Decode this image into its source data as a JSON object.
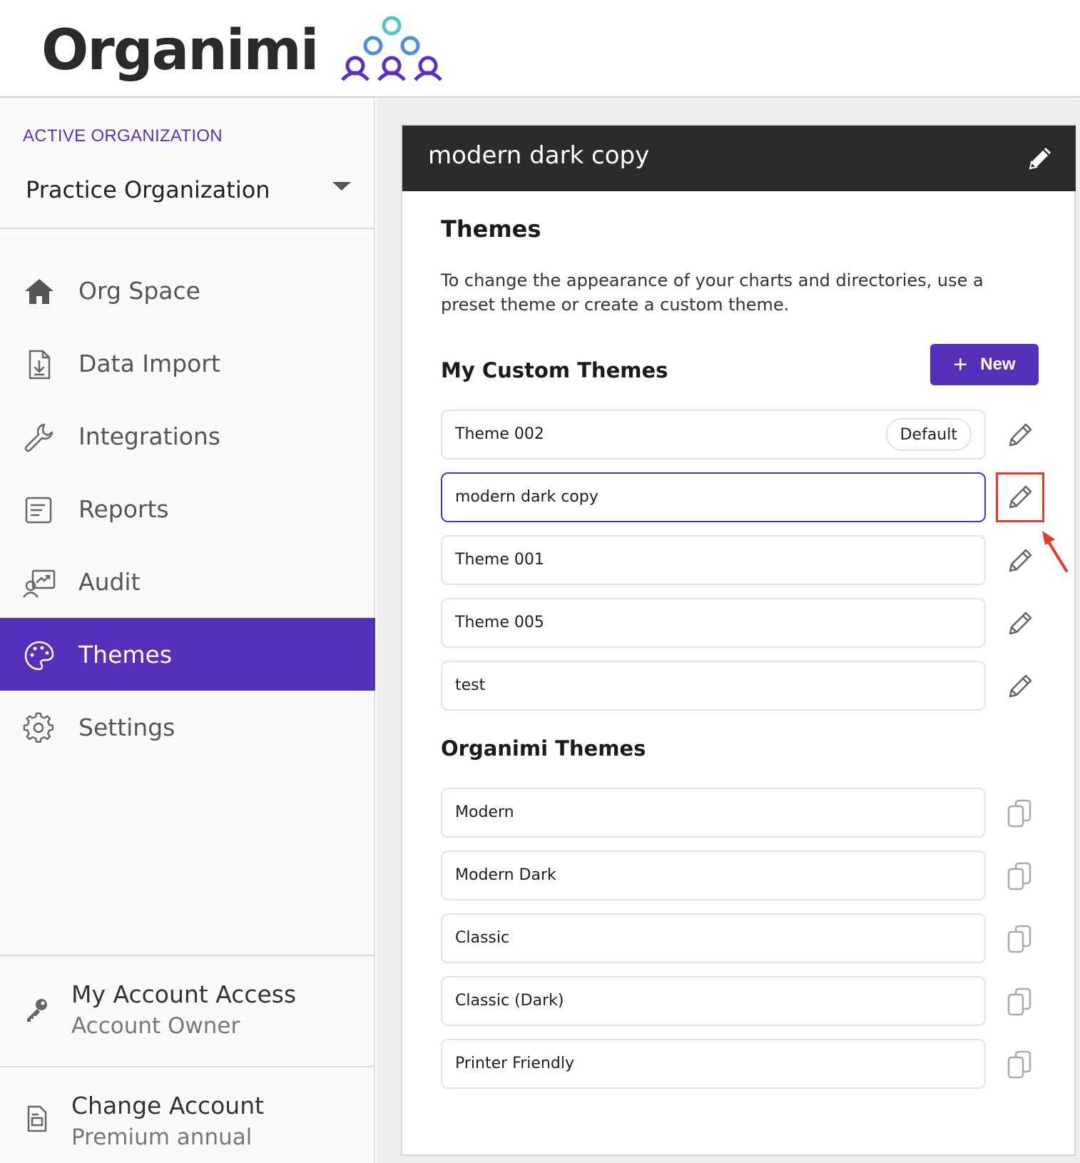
{
  "brand": {
    "name": "Organimi",
    "logo_icon": "people-hierarchy-logo"
  },
  "sidebar": {
    "org_label": "ACTIVE ORGANIZATION",
    "org_name": "Practice Organization",
    "items": [
      {
        "label": "Org Space",
        "icon": "home-icon"
      },
      {
        "label": "Data Import",
        "icon": "file-import-icon"
      },
      {
        "label": "Integrations",
        "icon": "wrench-icon"
      },
      {
        "label": "Reports",
        "icon": "report-icon"
      },
      {
        "label": "Audit",
        "icon": "audit-icon"
      },
      {
        "label": "Themes",
        "icon": "palette-icon",
        "active": true
      },
      {
        "label": "Settings",
        "icon": "gear-icon"
      }
    ],
    "account_access": {
      "title": "My Account Access",
      "subtitle": "Account Owner",
      "icon": "key-icon"
    },
    "change_account": {
      "title": "Change Account",
      "subtitle": "Premium annual",
      "icon": "document-icon"
    }
  },
  "panel": {
    "header_title": "modern dark copy",
    "title": "Themes",
    "description": "To change the appearance of your charts and directories, use a preset theme or create a custom theme.",
    "custom_section_title": "My Custom Themes",
    "new_button_label": "New",
    "custom_themes": [
      {
        "name": "Theme 002",
        "badge": "Default"
      },
      {
        "name": "modern dark copy",
        "selected": true
      },
      {
        "name": "Theme 001"
      },
      {
        "name": "Theme 005"
      },
      {
        "name": "test"
      }
    ],
    "organimi_section_title": "Organimi Themes",
    "organimi_themes": [
      {
        "name": "Modern"
      },
      {
        "name": "Modern Dark"
      },
      {
        "name": "Classic"
      },
      {
        "name": "Classic (Dark)"
      },
      {
        "name": "Printer Friendly"
      }
    ]
  },
  "colors": {
    "accent": "#5530b9",
    "header_dark": "#2b2b2b",
    "highlight": "#e53b2c"
  }
}
